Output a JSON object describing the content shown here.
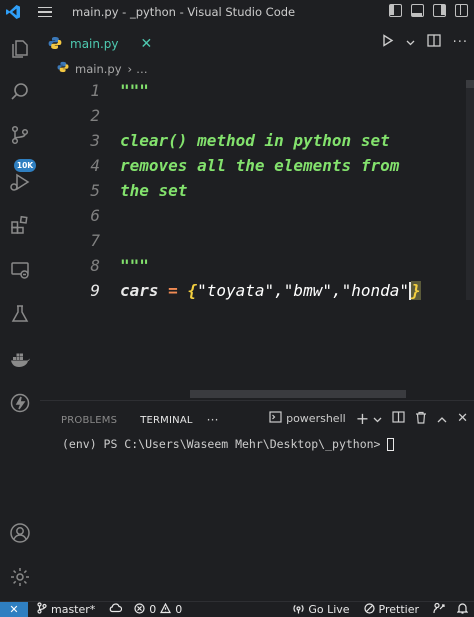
{
  "window": {
    "title": "main.py - _python - Visual Studio Code"
  },
  "activity_bar": {
    "source_control_badge": "10K",
    "icons": [
      "explorer-icon",
      "search-icon",
      "source-control-icon",
      "run-debug-icon",
      "extensions-icon",
      "remote-explorer-icon",
      "testing-icon",
      "docker-icon",
      "thunder-icon",
      "account-icon",
      "settings-gear-icon"
    ]
  },
  "editor": {
    "tab_label": "main.py",
    "tab_close": "✕",
    "breadcrumb": {
      "file": "main.py",
      "rest": "…"
    },
    "lines": [
      {
        "number": "1",
        "text": "\"\"\""
      },
      {
        "number": "2",
        "text": ""
      },
      {
        "number": "3",
        "text": "clear() method in python set"
      },
      {
        "number": "4",
        "text": "removes all the elements from"
      },
      {
        "number": "5",
        "text": "the set"
      },
      {
        "number": "6",
        "text": ""
      },
      {
        "number": "7",
        "text": ""
      },
      {
        "number": "8",
        "text": "\"\"\""
      },
      {
        "number": "9",
        "var": "cars",
        "op": "=",
        "open": "{",
        "s1": "\"toyata\"",
        "c1": ",",
        "s2": "\"bmw\"",
        "c2": ",",
        "s3": "\"honda\"",
        "close": "}"
      }
    ]
  },
  "panel": {
    "tabs": [
      "PROBLEMS",
      "TERMINAL",
      "···"
    ],
    "shell_label": "powershell",
    "prompt": "(env) PS C:\\Users\\Waseem Mehr\\Desktop\\_python>"
  },
  "statusbar": {
    "branch": "master*",
    "errors": "0",
    "warnings": "0",
    "go_live": "Go Live",
    "prettier": "Prettier"
  },
  "colors": {
    "accent": "#2f7fc1",
    "string_green": "#83e26d",
    "operator_orange": "#f28b54",
    "brace_yellow": "#f4d03f"
  }
}
